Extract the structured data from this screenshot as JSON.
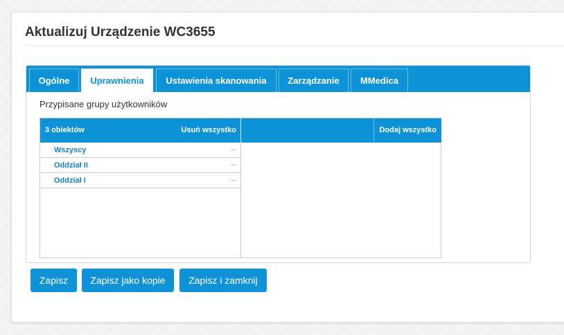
{
  "page": {
    "title": "Aktualizuj Urządzenie WC3655"
  },
  "tabs": [
    {
      "label": "Ogólne",
      "active": false
    },
    {
      "label": "Uprawnienia",
      "active": true
    },
    {
      "label": "Ustawienia skanowania",
      "active": false
    },
    {
      "label": "Zarządzanie",
      "active": false
    },
    {
      "label": "MMedica",
      "active": false
    }
  ],
  "permissions": {
    "subtitle": "Przypisane grupy użytkowników",
    "assigned": {
      "count_label": "3 obiektów",
      "remove_all_label": "Usuń wszystko",
      "items": [
        {
          "label": "Wszyscy"
        },
        {
          "label": "Oddział II"
        },
        {
          "label": "Oddział I"
        }
      ]
    },
    "available": {
      "add_all_label": "Dodaj wszystko",
      "items": []
    }
  },
  "buttons": {
    "save": "Zapisz",
    "save_copy": "Zapisz jako kopie",
    "save_close": "Zapisz i zamknij"
  },
  "colors": {
    "accent": "#0e93d8",
    "link": "#1a80c4"
  }
}
